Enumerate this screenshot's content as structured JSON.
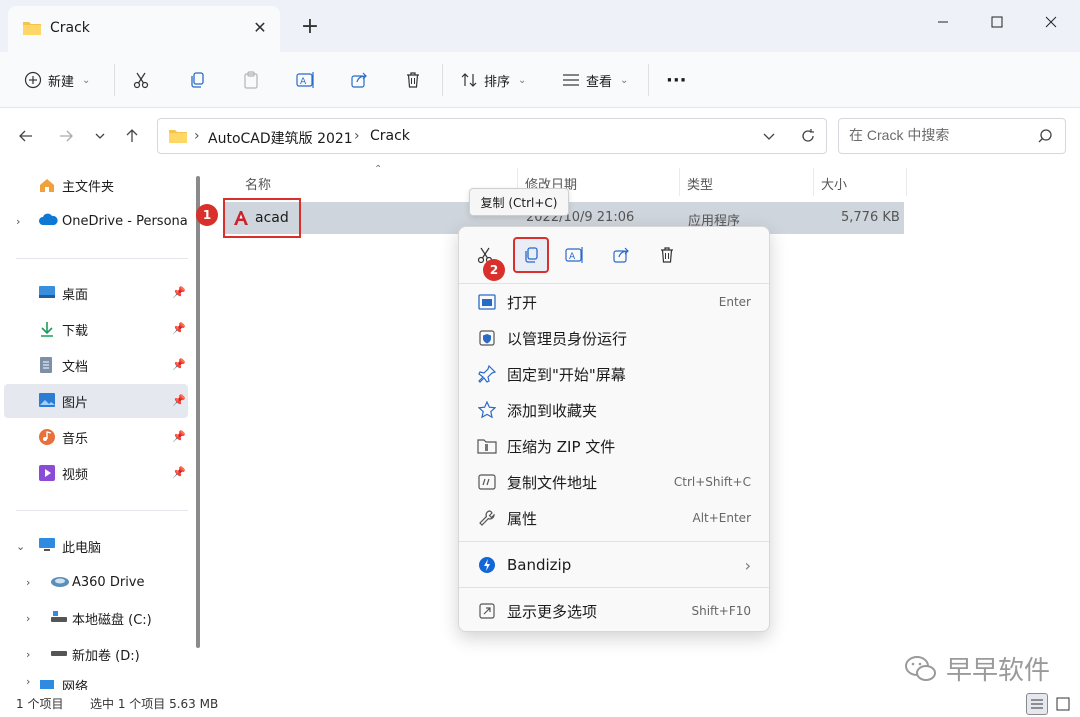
{
  "window": {
    "tab_title": "Crack",
    "tab_close": "✕",
    "new_tab": "+"
  },
  "toolbar": {
    "new_label": "新建",
    "sort_label": "排序",
    "view_label": "查看",
    "more_label": "···"
  },
  "address": {
    "crumbs": [
      "AutoCAD建筑版 2021",
      "Crack"
    ],
    "separator": "›"
  },
  "search": {
    "placeholder": "在 Crack 中搜索"
  },
  "sidebar": {
    "items": [
      {
        "label": "主文件夹"
      },
      {
        "label": "OneDrive - Persona"
      },
      {
        "label": "桌面"
      },
      {
        "label": "下载"
      },
      {
        "label": "文档"
      },
      {
        "label": "图片"
      },
      {
        "label": "音乐"
      },
      {
        "label": "视频"
      },
      {
        "label": "此电脑"
      },
      {
        "label": "A360 Drive"
      },
      {
        "label": "本地磁盘 (C:)"
      },
      {
        "label": "新加卷 (D:)"
      },
      {
        "label": "网络"
      }
    ]
  },
  "columns": {
    "name": "名称",
    "date": "修改日期",
    "type": "类型",
    "size": "大小"
  },
  "file": {
    "name": "acad",
    "date": "2022/10/9 21:06",
    "type": "应用程序",
    "size": "5,776 KB"
  },
  "tooltip": "复制 (Ctrl+C)",
  "badges": {
    "one": "1",
    "two": "2"
  },
  "context_menu": {
    "items": [
      {
        "label": "打开",
        "shortcut": "Enter"
      },
      {
        "label": "以管理员身份运行",
        "shortcut": ""
      },
      {
        "label": "固定到\"开始\"屏幕",
        "shortcut": ""
      },
      {
        "label": "添加到收藏夹",
        "shortcut": ""
      },
      {
        "label": "压缩为 ZIP 文件",
        "shortcut": ""
      },
      {
        "label": "复制文件地址",
        "shortcut": "Ctrl+Shift+C"
      },
      {
        "label": "属性",
        "shortcut": "Alt+Enter"
      },
      {
        "label": "Bandizip",
        "shortcut": "›"
      },
      {
        "label": "显示更多选项",
        "shortcut": "Shift+F10"
      }
    ]
  },
  "status": {
    "count": "1 个项目",
    "selected": "选中 1 个项目  5.63 MB"
  },
  "watermark": "早早软件",
  "colors": {
    "accent": "#0067c0",
    "highlight_red": "#d9302b",
    "title_bg": "#eef2f8"
  }
}
